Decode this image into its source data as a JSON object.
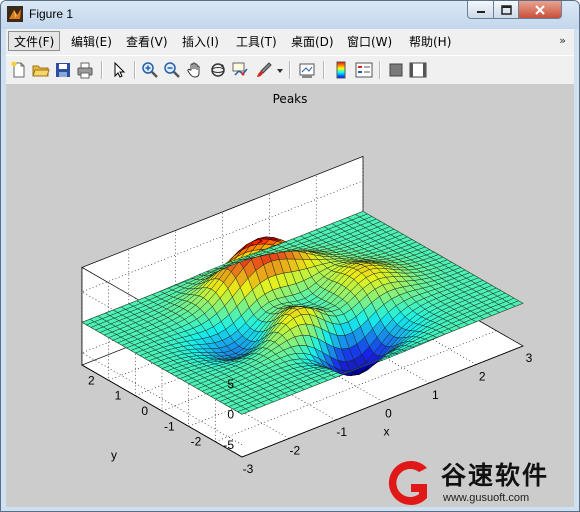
{
  "window": {
    "title": "Figure 1"
  },
  "menu": {
    "items": [
      "文件(F)",
      "编辑(E)",
      "查看(V)",
      "插入(I)",
      "工具(T)",
      "桌面(D)",
      "窗口(W)",
      "帮助(H)"
    ],
    "overflow": "»"
  },
  "toolbar": {
    "icons": [
      "new-figure-icon",
      "open-file-icon",
      "save-icon",
      "print-icon",
      "select-arrow-icon",
      "zoom-in-icon",
      "zoom-out-icon",
      "pan-hand-icon",
      "rotate-3d-icon",
      "data-cursor-icon",
      "brush-icon",
      "brush-dropdown-icon",
      "link-plot-icon",
      "colorbar-icon",
      "legend-icon",
      "hide-plot-tools-icon",
      "show-plot-tools-icon"
    ]
  },
  "chart_data": {
    "type": "surface",
    "title": "Peaks",
    "function": "peaks",
    "x": {
      "label": "x",
      "range": [
        -3,
        3
      ],
      "ticks": [
        -3,
        -2,
        -1,
        0,
        1,
        2,
        3
      ]
    },
    "y": {
      "label": "y",
      "range": [
        -3,
        3
      ],
      "ticks": [
        -2,
        -1,
        0,
        1,
        2
      ]
    },
    "z": {
      "label": "",
      "range": [
        -7,
        9
      ],
      "ticks": [
        -5,
        0,
        5
      ]
    },
    "grid": true,
    "colormap": "jet",
    "contour_plane_z": 0
  },
  "watermark": {
    "text": "谷速软件",
    "url": "www.gusuoft.com"
  }
}
